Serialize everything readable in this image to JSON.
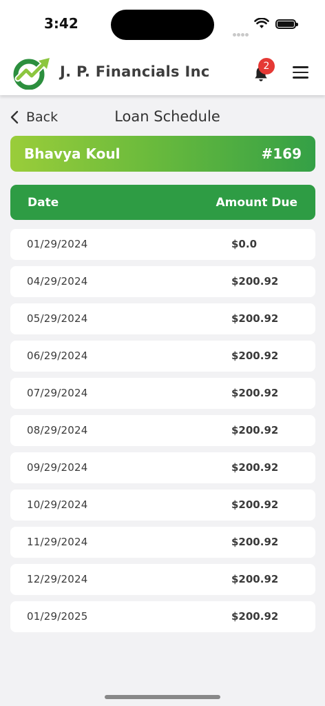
{
  "status": {
    "time": "3:42"
  },
  "header": {
    "brand": "J. P. Financials Inc",
    "notification_count": "2"
  },
  "nav": {
    "back_label": "Back",
    "title": "Loan Schedule"
  },
  "customer": {
    "name": "Bhavya Koul",
    "id": "#169"
  },
  "table": {
    "columns": [
      "Date",
      "Amount Due"
    ],
    "rows": [
      {
        "date": "01/29/2024",
        "amount": "$0.0"
      },
      {
        "date": "04/29/2024",
        "amount": "$200.92"
      },
      {
        "date": "05/29/2024",
        "amount": "$200.92"
      },
      {
        "date": "06/29/2024",
        "amount": "$200.92"
      },
      {
        "date": "07/29/2024",
        "amount": "$200.92"
      },
      {
        "date": "08/29/2024",
        "amount": "$200.92"
      },
      {
        "date": "09/29/2024",
        "amount": "$200.92"
      },
      {
        "date": "10/29/2024",
        "amount": "$200.92"
      },
      {
        "date": "11/29/2024",
        "amount": "$200.92"
      },
      {
        "date": "12/29/2024",
        "amount": "$200.92"
      },
      {
        "date": "01/29/2025",
        "amount": "$200.92"
      }
    ]
  },
  "icons": {
    "logo": "jp-financials-logo-icon",
    "notifications": "bell-icon",
    "menu": "hamburger-menu-icon",
    "back": "chevron-left-icon"
  },
  "colors": {
    "accent_green": "#2e9c44",
    "gradient_start": "#9acd3a",
    "badge_red": "#e53935"
  }
}
